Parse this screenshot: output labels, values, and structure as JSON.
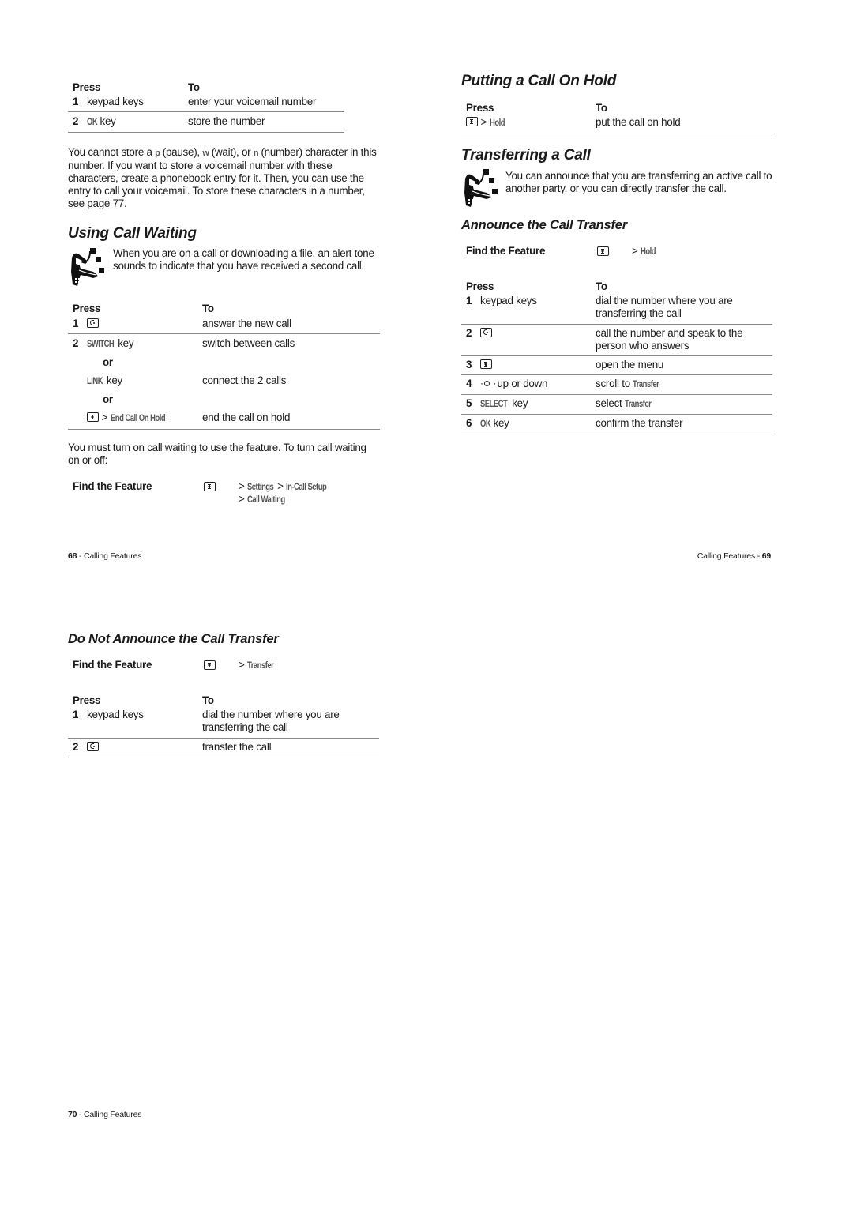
{
  "page68": {
    "voicemail_table": {
      "headers": {
        "press": "Press",
        "to": "To"
      },
      "rows": [
        {
          "num": "1",
          "press_text": "keypad keys",
          "to": "enter your voicemail number"
        },
        {
          "num": "2",
          "press_display": "OK",
          "press_text": " key",
          "to": "store the number"
        }
      ]
    },
    "voicemail_note": {
      "part1": "You cannot store a ",
      "char_p": "p",
      "part2": " (pause), ",
      "char_w": "w",
      "part3": " (wait), or ",
      "char_n": "n",
      "part4": " (number) character in this number. If you want to store a voicemail number with these characters, create a phonebook entry for it. Then, you can use the entry to call your voicemail. To store these characters in a number, see page 77."
    },
    "call_waiting": {
      "title": "Using Call Waiting",
      "icon": "network-feature-icon",
      "intro": "When you are on a call or downloading a file, an alert tone sounds to indicate that you have received a second call.",
      "table": {
        "headers": {
          "press": "Press",
          "to": "To"
        },
        "row1": {
          "num": "1",
          "press_icon": "send-key-icon",
          "to": "answer the new call"
        },
        "row2": {
          "num": "2",
          "opt1": {
            "display": "SWITCH",
            "text": " key",
            "to": "switch between calls"
          },
          "or1": "or",
          "opt2": {
            "display": "LINK",
            "text": " key",
            "to": "connect the 2 calls"
          },
          "or2": "or",
          "opt3": {
            "press_icon": "menu-key-icon",
            "sep": " > ",
            "display": "End Call On Hold",
            "to": "end the call on hold"
          }
        }
      },
      "note": "You must turn on call waiting to use the feature. To turn call waiting on or off:",
      "find_feature": {
        "label": "Find the Feature",
        "icon": "menu-key-icon",
        "path_line1_sep1": "> ",
        "path_line1_item1": "Settings",
        "path_line1_sep2": " > ",
        "path_line1_item2": "In-Call Setup",
        "path_line2_sep": "> ",
        "path_line2_item": "Call Waiting"
      }
    },
    "footer": {
      "page_num": "68",
      "sep": " - ",
      "section": "Calling Features"
    }
  },
  "page69": {
    "hold": {
      "title": "Putting a Call On Hold",
      "table": {
        "headers": {
          "press": "Press",
          "to": "To"
        },
        "row": {
          "press_icon": "menu-key-icon",
          "sep": " > ",
          "display": "Hold",
          "to": "put the call on hold"
        }
      }
    },
    "transfer": {
      "title": "Transferring a Call",
      "icon": "network-feature-icon",
      "intro": "You can announce that you are transferring an active call to another party, or you can directly transfer the call."
    },
    "announce": {
      "title": "Announce the Call Transfer",
      "find_feature": {
        "label": "Find the Feature",
        "icon": "menu-key-icon",
        "sep": "> ",
        "item": "Hold"
      },
      "table": {
        "headers": {
          "press": "Press",
          "to": "To"
        },
        "rows": [
          {
            "num": "1",
            "press_text": "keypad keys",
            "to": "dial the number where you are transferring the call"
          },
          {
            "num": "2",
            "press_icon": "send-key-icon",
            "to": "call the number and speak to the person who answers"
          },
          {
            "num": "3",
            "press_icon": "menu-key-icon",
            "to": "open the menu"
          },
          {
            "num": "4",
            "press_icon": "nav-key-icon",
            "press_text": " up or down",
            "to_text": "scroll to ",
            "to_display": "Transfer"
          },
          {
            "num": "5",
            "press_display": "SELECT",
            "press_text": " key",
            "to_text": "select ",
            "to_display": "Transfer"
          },
          {
            "num": "6",
            "press_display": "OK",
            "press_text": " key",
            "to": "confirm the transfer"
          }
        ]
      }
    },
    "footer": {
      "section": "Calling Features",
      "sep": " - ",
      "page_num": "69"
    }
  },
  "page70": {
    "no_announce": {
      "title": "Do Not Announce the Call Transfer",
      "find_feature": {
        "label": "Find the Feature",
        "icon": "menu-key-icon",
        "sep": "> ",
        "item": "Transfer"
      },
      "table": {
        "headers": {
          "press": "Press",
          "to": "To"
        },
        "rows": [
          {
            "num": "1",
            "press_text": "keypad keys",
            "to": "dial the number where you are transferring the call"
          },
          {
            "num": "2",
            "press_icon": "send-key-icon",
            "to": "transfer the call"
          }
        ]
      }
    },
    "footer": {
      "page_num": "70",
      "sep": " - ",
      "section": "Calling Features"
    }
  }
}
